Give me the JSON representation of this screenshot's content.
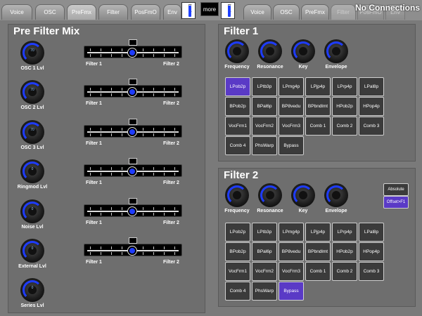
{
  "tabs_left": [
    "Voice",
    "OSC",
    "PreFmx",
    "Filter",
    "PosFmO",
    "Env"
  ],
  "bank_label": "bank",
  "more_label": "more",
  "tabs_right": [
    "Voice",
    "OSC",
    "PreFmx",
    "Filter",
    "PosFmO",
    "Env"
  ],
  "connection_status": "No Connections",
  "prefilter": {
    "title": "Pre Filter Mix",
    "knobs": [
      {
        "label": "OSC 1 Lvl",
        "value": "70"
      },
      {
        "label": "OSC 2 Lvl",
        "value": "70"
      },
      {
        "label": "OSC 3 Lvl",
        "value": "70"
      },
      {
        "label": "Ringmod Lvl",
        "value": "0"
      },
      {
        "label": "Noise Lvl",
        "value": "0"
      },
      {
        "label": "External Lvl",
        "value": "0"
      },
      {
        "label": "Series Lvl",
        "value": "0"
      }
    ],
    "slider_left_label": "Filter 1",
    "slider_right_label": "Filter 2",
    "slider_positions": [
      0.5,
      0.5,
      0.5,
      0.5,
      0.5,
      0.5
    ]
  },
  "filter1": {
    "title": "Filter 1",
    "knobs": [
      "Frequency",
      "Resonance",
      "Key",
      "Envelope"
    ],
    "types": [
      "LPob2p",
      "LPtb3p",
      "LPmg4p",
      "LPjp4p",
      "LPrp4p",
      "LPal8p",
      "BPob2p",
      "BPal6p",
      "BP8vedu",
      "BPbndlmt",
      "HPob2p",
      "HPop4p",
      "VocFrm1",
      "VocFrm2",
      "VocFrm3",
      "Comb 1",
      "Comb 2",
      "Comb 3",
      "Comb 4",
      "PhsWarp",
      "Bypass"
    ],
    "selected": "LPob2p"
  },
  "filter2": {
    "title": "Filter 2",
    "knobs": [
      "Frequency",
      "Resonance",
      "Key",
      "Envelope"
    ],
    "mode_buttons": [
      "Absolute",
      "Offset>F1"
    ],
    "mode_selected": "Offset>F1",
    "types": [
      "LPob2p",
      "LPtb3p",
      "LPmg4p",
      "LPjp4p",
      "LPrp4p",
      "LPal8p",
      "BPob2p",
      "BPal6p",
      "BP8vedu",
      "BPbndlmt",
      "HPob2p",
      "HPop4p",
      "VocFrm1",
      "VocFrm2",
      "VocFrm3",
      "Comb 1",
      "Comb 2",
      "Comb 3",
      "Comb 4",
      "PhsWarp",
      "Bypass"
    ],
    "selected": "Bypass"
  }
}
